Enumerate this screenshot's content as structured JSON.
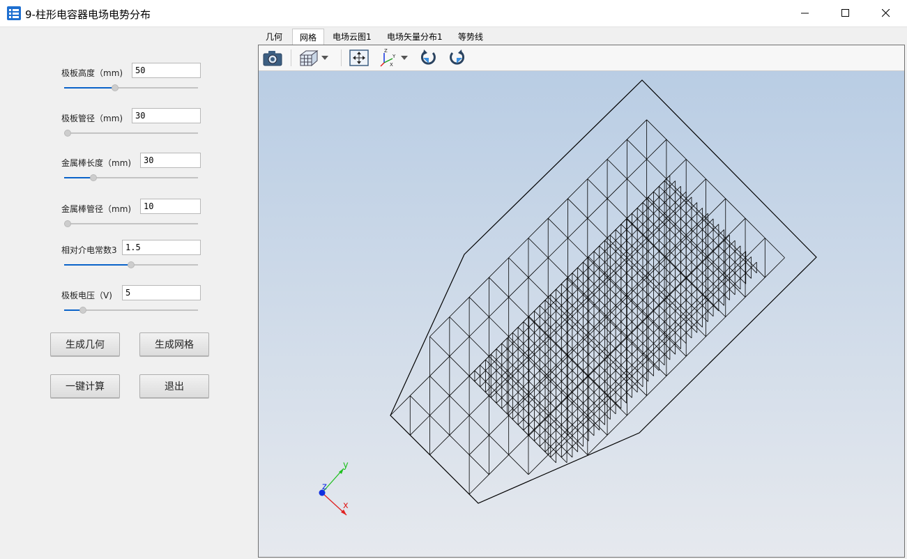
{
  "window": {
    "title": "9-柱形电容器电场电势分布"
  },
  "params": [
    {
      "label": "极板高度（mm)",
      "value": "50",
      "slider": 0.38
    },
    {
      "label": "极板管径（mm)",
      "value": "30",
      "slider": 0.0
    },
    {
      "label": "金属棒长度（mm)",
      "value": "30",
      "slider": 0.22
    },
    {
      "label": "金属棒管径（mm)",
      "value": "10",
      "slider": 0.0
    },
    {
      "label": "相对介电常数3",
      "value": "1.5",
      "slider": 0.5
    },
    {
      "label": "极板电压（V)",
      "value": "5",
      "slider": 0.14
    }
  ],
  "buttons": {
    "gen_geometry": "生成几何",
    "gen_mesh": "生成网格",
    "compute": "一键计算",
    "exit": "退出"
  },
  "tabs": [
    {
      "label": "几何",
      "active": false
    },
    {
      "label": "网格",
      "active": true
    },
    {
      "label": "电场云图1",
      "active": false
    },
    {
      "label": "电场矢量分布1",
      "active": false
    },
    {
      "label": "等势线",
      "active": false
    }
  ],
  "toolbar": [
    "camera-icon",
    "view-cube-icon",
    "zoom-extents-icon",
    "axes-orientation-icon",
    "rotate-cw-icon",
    "rotate-ccw-icon"
  ],
  "triad": {
    "x": "x",
    "y": "y",
    "z": "z"
  },
  "colors": {
    "accent": "#0a63c9",
    "viewport_top": "#b9cde4",
    "viewport_bottom": "#e6e9ee",
    "axis_x": "#e02020",
    "axis_y": "#20c020",
    "axis_z": "#1030e0"
  }
}
